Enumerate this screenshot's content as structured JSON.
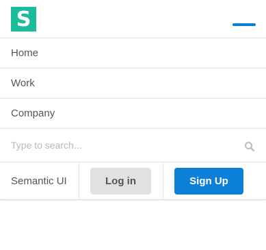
{
  "brand": {
    "logo_letter": "S",
    "logo_color": "#1abc9c"
  },
  "accent_color": "#0c7fd6",
  "nav": {
    "items": [
      {
        "label": "Home"
      },
      {
        "label": "Work"
      },
      {
        "label": "Company"
      }
    ]
  },
  "search": {
    "placeholder": "Type to search...",
    "value": ""
  },
  "footer": {
    "brand_text": "Semantic UI",
    "login_label": "Log in",
    "signup_label": "Sign Up"
  }
}
